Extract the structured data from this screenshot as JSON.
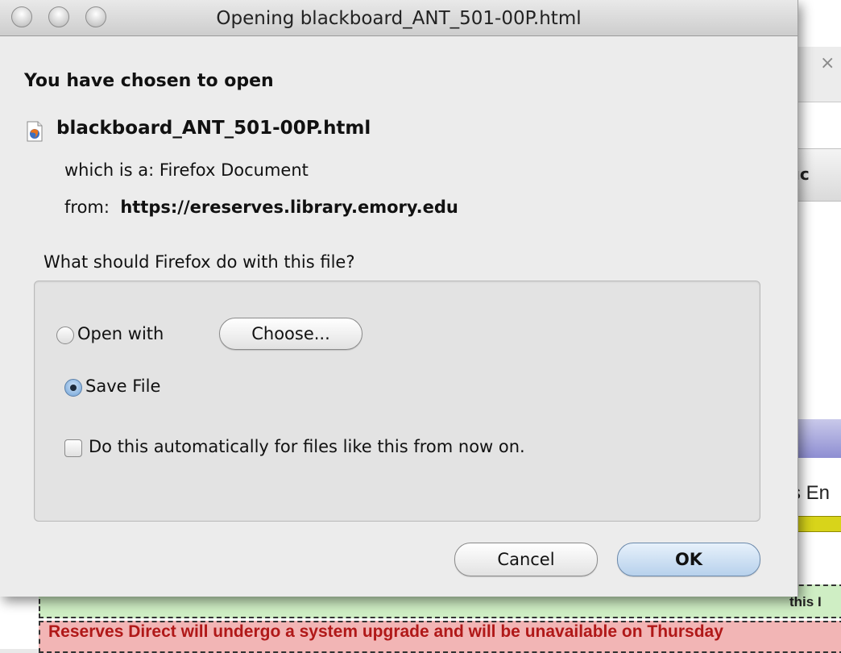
{
  "dialog": {
    "title": "Opening blackboard_ANT_501-00P.html",
    "heading": "You have chosen to open",
    "filename": "blackboard_ANT_501-00P.html",
    "file_icon": "firefox-document-icon",
    "which_is_label": "which is a:  Firefox Document",
    "from_label": "from:",
    "from_value": "https://ereserves.library.emory.edu",
    "question": "What should Firefox do with this file?",
    "open_with_label": "Open with",
    "choose_button": "Choose...",
    "save_file_label": "Save File",
    "selected_option": "save-file",
    "auto_checkbox_label": "Do this automatically for files like this from now on.",
    "auto_checkbox_checked": false,
    "cancel_button": "Cancel",
    "ok_button": "OK"
  },
  "background": {
    "close_glyph": "×",
    "tab_fragment": "ıc",
    "text_fragment": "s En",
    "green_bar_fragment": "this I",
    "red_bar_text": "Reserves Direct will undergo a system upgrade and will be unavailable on Thursday"
  }
}
